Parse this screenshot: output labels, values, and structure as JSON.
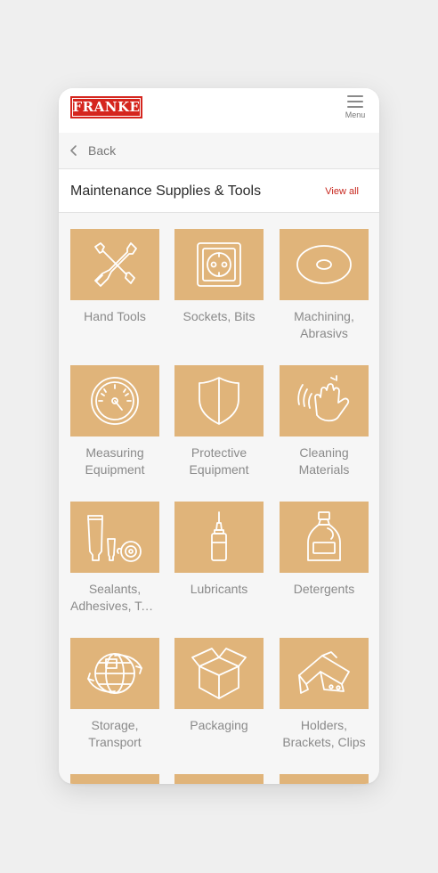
{
  "header": {
    "logo_text": "FRANKE",
    "menu_label": "Menu"
  },
  "nav": {
    "back_label": "Back"
  },
  "section": {
    "title": "Maintenance Supplies & Tools",
    "view_all": "View all"
  },
  "categories": [
    {
      "l1": "Hand Tools",
      "l2": "",
      "icon": "wrench-screwdriver-icon"
    },
    {
      "l1": "Sockets, Bits",
      "l2": "",
      "icon": "socket-icon"
    },
    {
      "l1": "Machining,",
      "l2": "Abrasivs",
      "icon": "abrasive-disc-icon"
    },
    {
      "l1": "Measuring",
      "l2": "Equipment",
      "icon": "gauge-icon"
    },
    {
      "l1": "Protective",
      "l2": "Equipment",
      "icon": "shield-icon"
    },
    {
      "l1": "Cleaning",
      "l2": "Materials",
      "icon": "cleaning-glove-icon"
    },
    {
      "l1": "Sealants,",
      "l2": "Adhesives, Ta…",
      "icon": "tubes-tape-icon"
    },
    {
      "l1": "Lubricants",
      "l2": "",
      "icon": "oil-bottle-icon"
    },
    {
      "l1": "Detergents",
      "l2": "",
      "icon": "detergent-jug-icon"
    },
    {
      "l1": "Storage,",
      "l2": "Transport",
      "icon": "globe-transport-icon"
    },
    {
      "l1": "Packaging",
      "l2": "",
      "icon": "box-icon"
    },
    {
      "l1": "Holders,",
      "l2": "Brackets, Clips",
      "icon": "bracket-icon"
    }
  ]
}
